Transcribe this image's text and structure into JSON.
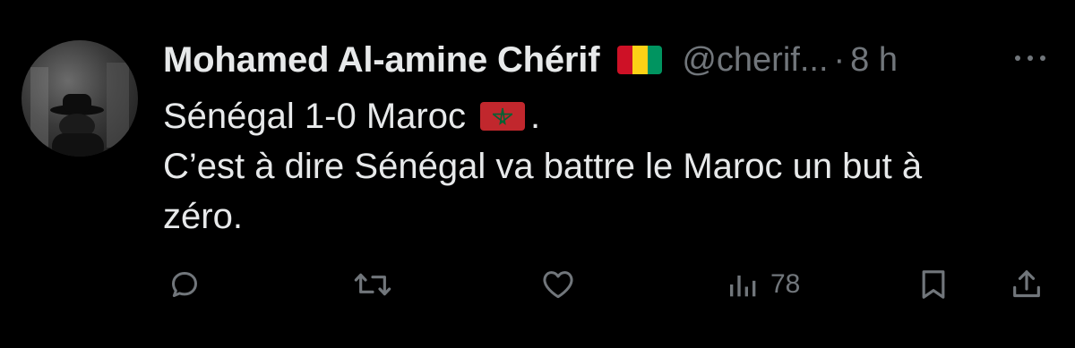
{
  "tweet": {
    "author": {
      "display_name": "Mohamed Al-amine Chérif",
      "handle": "@cherif...",
      "separator": "·",
      "time": "8 h",
      "avatar_icon": "avatar-photo",
      "flag_icon": "guinea-flag-icon"
    },
    "text": {
      "line1": "Sénégal 1-0 Maroc",
      "line1_suffix": ".",
      "line2": "C’est à dire Sénégal va battre le Maroc un but à",
      "line3": "zéro.",
      "flag_icon": "morocco-flag-icon"
    },
    "actions": {
      "reply_icon": "reply-icon",
      "retweet_icon": "retweet-icon",
      "like_icon": "heart-icon",
      "views_icon": "views-icon",
      "views_count": "78",
      "bookmark_icon": "bookmark-icon",
      "share_icon": "share-icon"
    },
    "colors": {
      "background": "#000000",
      "text": "#e7e9ea",
      "secondary": "#71767b",
      "guinea_red": "#ce1126",
      "guinea_yellow": "#fcd116",
      "guinea_green": "#009460",
      "morocco_red": "#c1272d",
      "morocco_green": "#006233"
    }
  }
}
